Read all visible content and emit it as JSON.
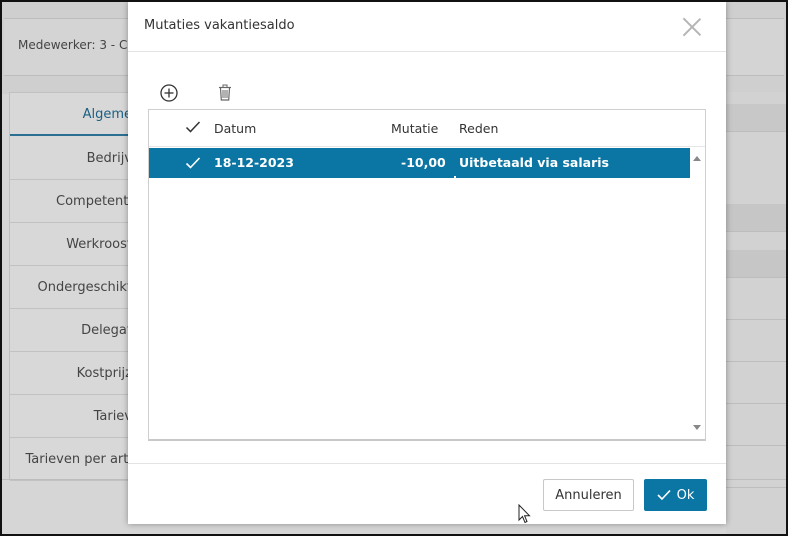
{
  "background": {
    "employee_label": "Medewerker: 3 - C",
    "side_items": [
      {
        "label": "Algeme",
        "active": true
      },
      {
        "label": "Bedrijv",
        "active": false
      },
      {
        "label": "Competenti",
        "active": false
      },
      {
        "label": "Werkroost",
        "active": false
      },
      {
        "label": "Ondergeschikt",
        "active": false
      },
      {
        "label": "Delegat",
        "active": false
      },
      {
        "label": "Kostprijz",
        "active": false
      },
      {
        "label": "Tariev",
        "active": false
      },
      {
        "label": "Tarieven per arti",
        "active": false
      }
    ]
  },
  "modal": {
    "title": "Mutaties vakantiesaldo",
    "toolbar": {
      "add_icon": "plus-circle-icon",
      "delete_icon": "trash-icon"
    },
    "columns": {
      "check": "check-icon",
      "date": "Datum",
      "mutation": "Mutatie",
      "reason": "Reden"
    },
    "rows": [
      {
        "date": "18-12-2023",
        "mutation": "-10,00",
        "reason": "Uitbetaald via salaris",
        "selected": true
      }
    ],
    "footer": {
      "cancel_label": "Annuleren",
      "ok_label": "Ok"
    }
  },
  "colors": {
    "accent": "#0b76a3",
    "overlay": "#d6d6d6"
  }
}
